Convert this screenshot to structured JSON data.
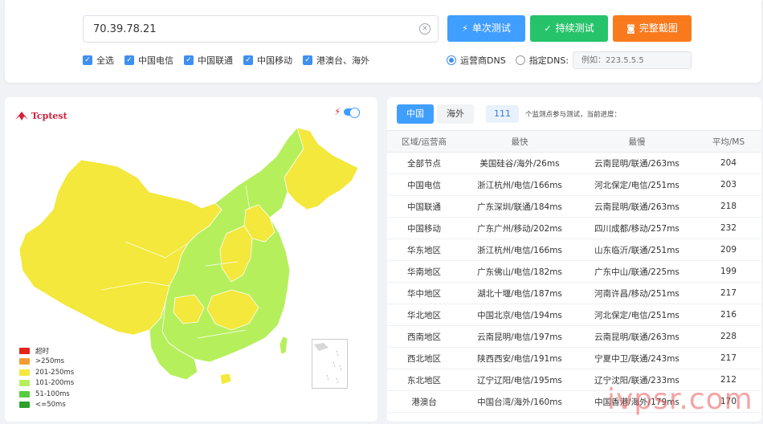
{
  "search": {
    "value": "70.39.78.21"
  },
  "buttons": {
    "single": "单次测试",
    "continuous": "持续测试",
    "screenshot": "完整截图"
  },
  "filters": [
    {
      "label": "全选",
      "checked": true
    },
    {
      "label": "中国电信",
      "checked": true
    },
    {
      "label": "中国联通",
      "checked": true
    },
    {
      "label": "中国移动",
      "checked": true
    },
    {
      "label": "港澳台、海外",
      "checked": true
    }
  ],
  "dns": {
    "option_isp": "运营商DNS",
    "option_custom": "指定DNS:",
    "selected": "isp",
    "placeholder": "例如：223.5.5.5"
  },
  "map": {
    "logo": "Tcptest",
    "legend": [
      {
        "label": "超时",
        "color": "#e4241a"
      },
      {
        "label": ">250ms",
        "color": "#f39c32"
      },
      {
        "label": "201-250ms",
        "color": "#f3e83b"
      },
      {
        "label": "101-200ms",
        "color": "#b6ef5c"
      },
      {
        "label": "51-100ms",
        "color": "#54cd3e"
      },
      {
        "label": "<=50ms",
        "color": "#2ba12b"
      }
    ]
  },
  "results": {
    "tab_china": "中国",
    "tab_overseas": "海外",
    "count": "111",
    "count_text": "个监测点参与测试，当前进度：",
    "headers": [
      "区域/运营商",
      "最快",
      "最慢",
      "平均/MS"
    ],
    "rows": [
      [
        "全部节点",
        "美国硅谷/海外/26ms",
        "云南昆明/联通/263ms",
        "204"
      ],
      [
        "中国电信",
        "浙江杭州/电信/166ms",
        "河北保定/电信/251ms",
        "203"
      ],
      [
        "中国联通",
        "广东深圳/联通/184ms",
        "云南昆明/联通/263ms",
        "218"
      ],
      [
        "中国移动",
        "广东广州/移动/202ms",
        "四川成都/移动/257ms",
        "232"
      ],
      [
        "华东地区",
        "浙江杭州/电信/166ms",
        "山东临沂/联通/251ms",
        "209"
      ],
      [
        "华南地区",
        "广东佛山/电信/182ms",
        "广东中山/联通/225ms",
        "199"
      ],
      [
        "华中地区",
        "湖北十堰/电信/187ms",
        "河南许昌/移动/251ms",
        "217"
      ],
      [
        "华北地区",
        "中国北京/电信/194ms",
        "河北保定/电信/251ms",
        "216"
      ],
      [
        "西南地区",
        "云南昆明/电信/197ms",
        "云南昆明/联通/263ms",
        "228"
      ],
      [
        "西北地区",
        "陕西西安/电信/191ms",
        "宁夏中卫/联通/243ms",
        "217"
      ],
      [
        "东北地区",
        "辽宁辽阳/电信/195ms",
        "辽宁沈阳/联通/233ms",
        "212"
      ],
      [
        "港澳台",
        "中国台湾/海外/160ms",
        "中国香港/海外/179ms",
        "170"
      ]
    ]
  },
  "watermark": "ivpsr.com"
}
